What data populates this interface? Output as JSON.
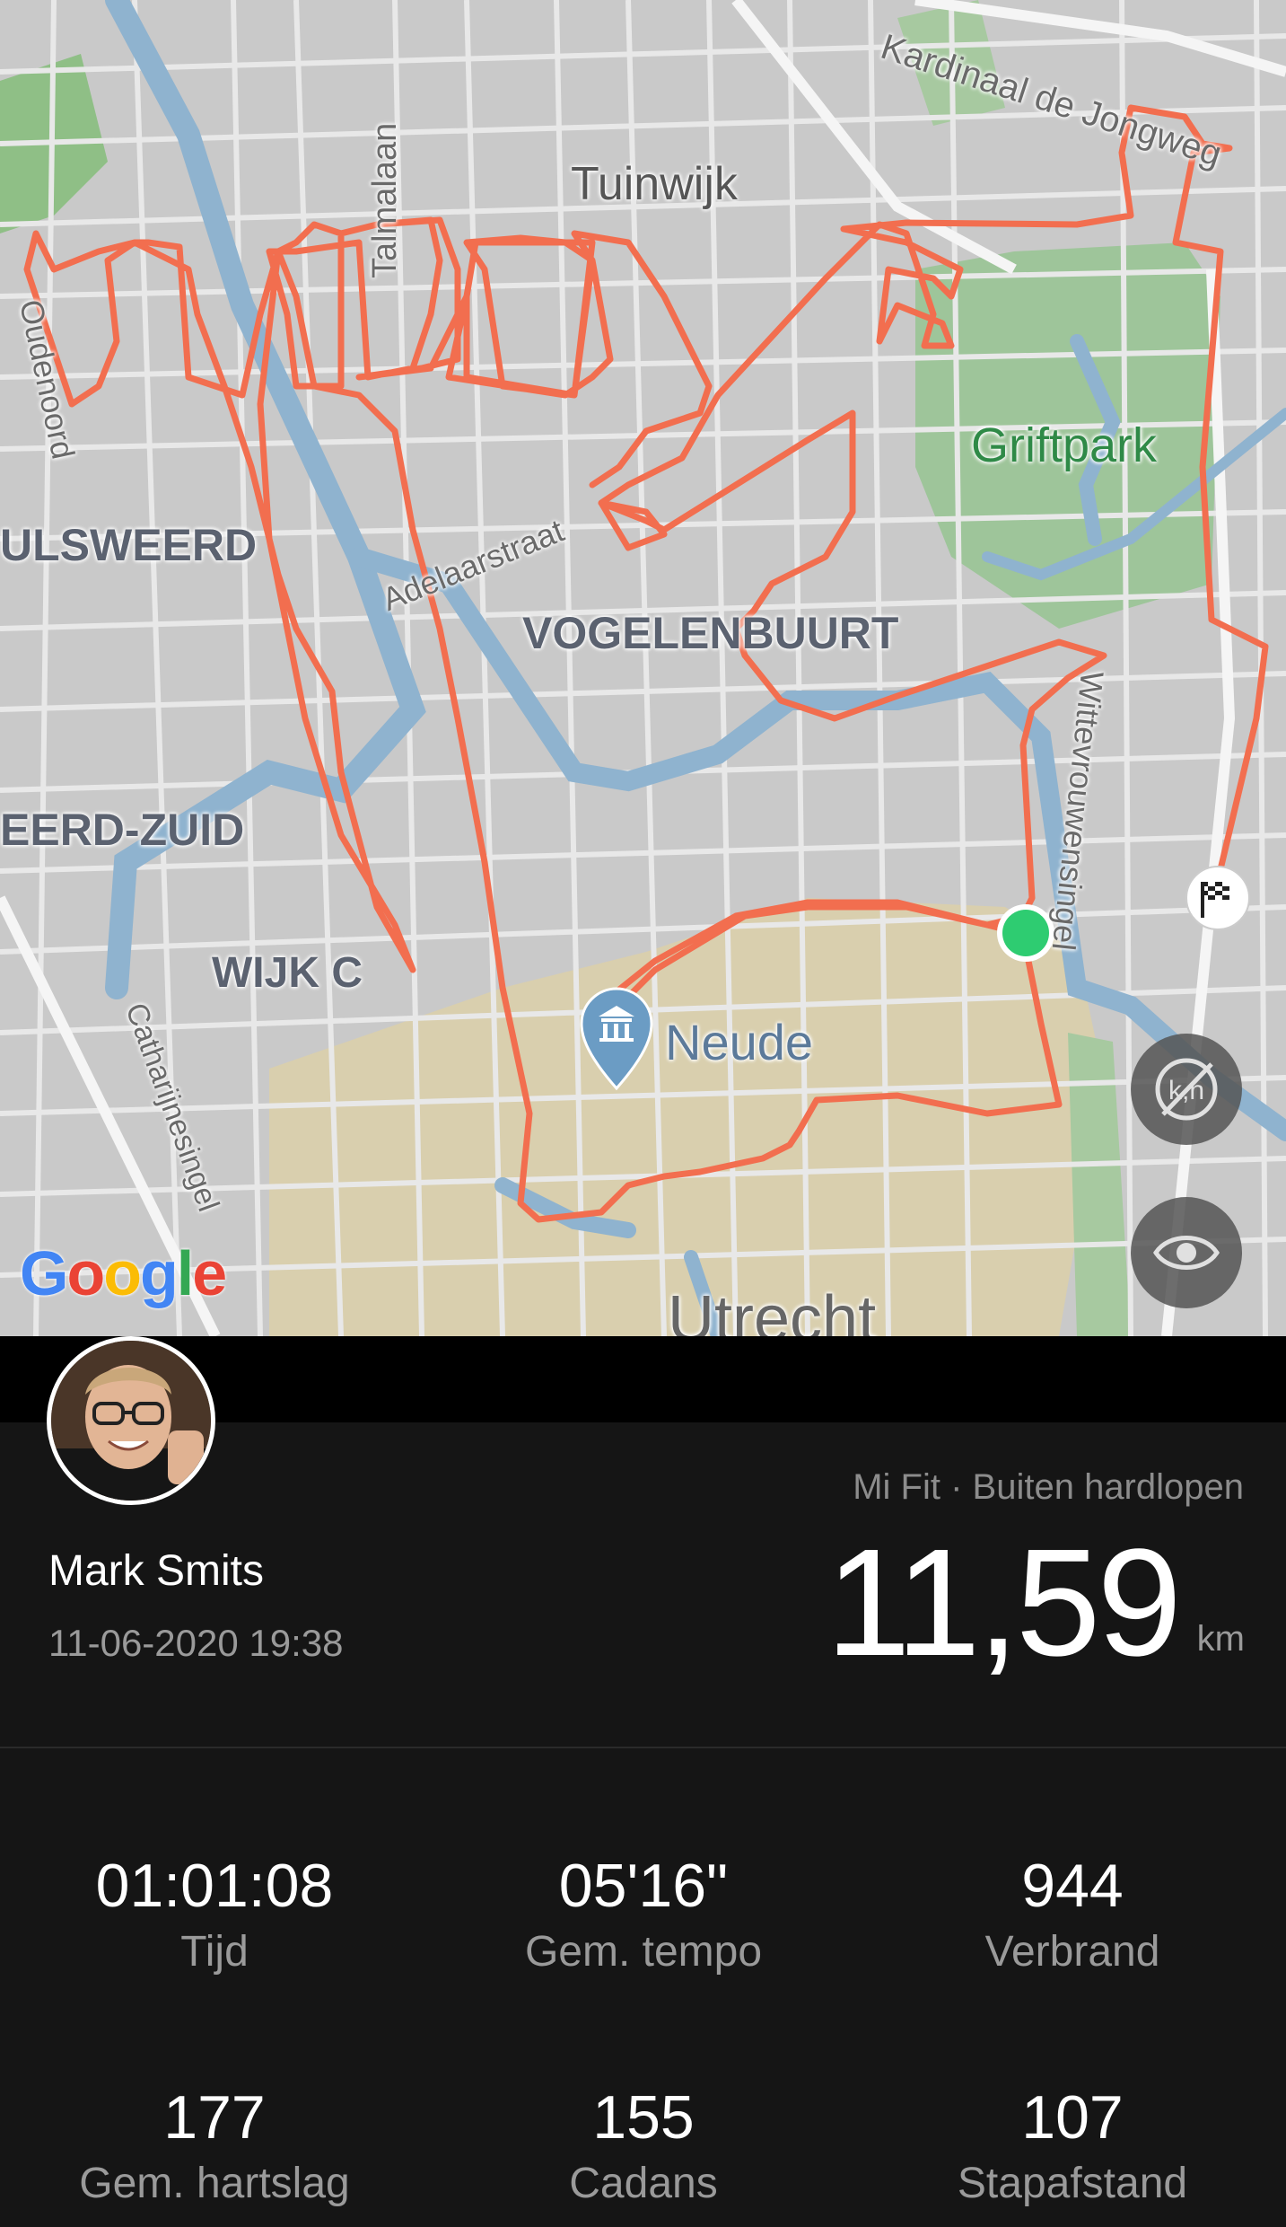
{
  "map": {
    "labels": {
      "kardinaal": "Kardinaal de Jongweg",
      "tuinwijk": "Tuinwijk",
      "talmalaan": "Talmalaan",
      "oudenoord": "Oudenoord",
      "griftpark": "Griftpark",
      "zuilensweerd": "ULSWEERD",
      "adelaarstraat": "Adelaarstraat",
      "vogelenbuurt": "VOGELENBUURT",
      "weerd_zuid": "EERD-ZUID",
      "wittevrouwensingel": "Wittevrouwensingel",
      "wijk_c": "WIJK C",
      "neude": "Neude",
      "catharijnesingel": "Catharijnesingel",
      "utrecht": "Utrecht"
    },
    "google_logo": "Google",
    "route_color": "#f26e4f",
    "start_color": "#2ecc71",
    "toggle_units_icon": "km-off-icon",
    "visibility_icon": "eye-icon",
    "finish_icon": "checkered-flag-icon",
    "museum_icon": "museum-pin-icon"
  },
  "activity": {
    "user_name": "Mark Smits",
    "datetime": "11-06-2020 19:38",
    "source": "Mi Fit · Buiten hardlopen",
    "distance": "11,59",
    "distance_unit": "km"
  },
  "stats": [
    {
      "value": "01:01:08",
      "label": "Tijd"
    },
    {
      "value": "05'16\"",
      "label": "Gem. tempo"
    },
    {
      "value": "944",
      "label": "Verbrand"
    },
    {
      "value": "177",
      "label": "Gem. hartslag"
    },
    {
      "value": "155",
      "label": "Cadans"
    },
    {
      "value": "107",
      "label": "Stapafstand"
    }
  ]
}
